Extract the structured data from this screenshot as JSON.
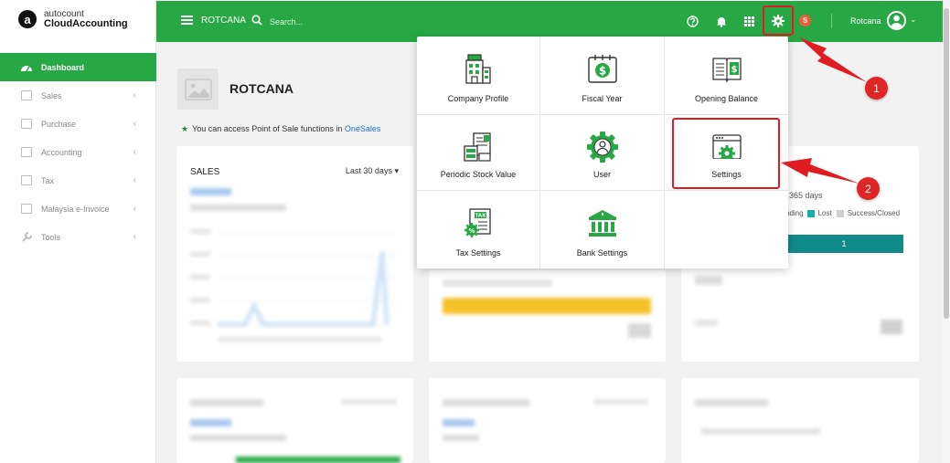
{
  "brand": {
    "logo_letter": "a",
    "name_top": "autocount",
    "name_bottom": "CloudAccounting"
  },
  "sidebar": {
    "items": [
      {
        "label": "Dashboard",
        "active": true
      },
      {
        "label": "Sales",
        "chevron": "‹"
      },
      {
        "label": "Purchase",
        "chevron": "‹"
      },
      {
        "label": "Accounting",
        "chevron": "‹"
      },
      {
        "label": "Tax",
        "chevron": "‹"
      },
      {
        "label": "Malaysia e-Invoice",
        "chevron": "‹"
      },
      {
        "label": "Tools",
        "chevron": "‹"
      }
    ]
  },
  "topbar": {
    "company": "ROTCANA",
    "search_placeholder": "Search...",
    "user_name": "Rotcana",
    "user_badge": "S",
    "user_chevron": "⌄"
  },
  "main": {
    "company_title": "ROTCANA",
    "pos_note_prefix": "You can access Point of Sale functions in",
    "pos_note_link": "OneSales",
    "sales_card": {
      "title": "SALES",
      "range": "Last 30 days",
      "range_caret": "▾"
    },
    "right_card": {
      "range": "365 days",
      "legend_pending": "nding",
      "legend_lost": "Lost",
      "legend_success": "Success/Closed",
      "bar_value": "1"
    }
  },
  "settings_menu": {
    "items": [
      {
        "label": "Company Profile",
        "icon": "building-icon"
      },
      {
        "label": "Fiscal Year",
        "icon": "calendar-dollar-icon"
      },
      {
        "label": "Opening Balance",
        "icon": "ledger-book-icon"
      },
      {
        "label": "Periodic Stock Value",
        "icon": "stock-document-icon"
      },
      {
        "label": "User",
        "icon": "user-gear-icon"
      },
      {
        "label": "Settings",
        "icon": "settings-window-icon"
      },
      {
        "label": "Tax Settings",
        "icon": "tax-document-icon"
      },
      {
        "label": "Bank Settings",
        "icon": "bank-icon"
      }
    ]
  },
  "annotations": {
    "marker_1": "1",
    "marker_2": "2"
  },
  "colors": {
    "brand_green": "#27a844",
    "highlight_red": "#e11b22",
    "teal": "#14a0a0"
  }
}
